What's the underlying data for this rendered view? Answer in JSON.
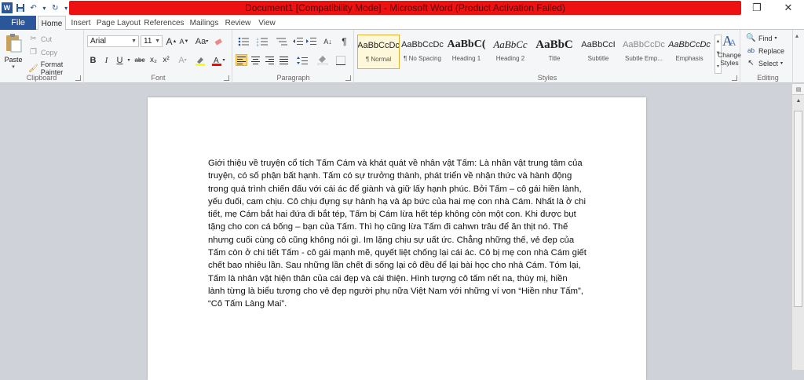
{
  "window": {
    "title": "Document1 [Compatibility Mode] - Microsoft Word (Product Activation Failed)",
    "logo": "W",
    "minimize": "—",
    "restore": "❐",
    "close": "✕"
  },
  "qat": {
    "save": "💾",
    "undo": "↶",
    "redo": "↻",
    "more": "▾"
  },
  "tabs": {
    "file": "File",
    "items": [
      "Home",
      "Insert",
      "Page Layout",
      "References",
      "Mailings",
      "Review",
      "View"
    ]
  },
  "clipboard": {
    "label": "Clipboard",
    "paste": "Paste",
    "cut": "Cut",
    "copy": "Copy",
    "format_painter": "Format Painter"
  },
  "font": {
    "label": "Font",
    "family": "Arial",
    "size": "11",
    "grow": "A",
    "shrink": "A",
    "case": "Aa",
    "bold": "B",
    "italic": "I",
    "underline": "U",
    "strike": "abc",
    "subscript": "x₂",
    "superscript": "x²",
    "highlight_color": "#ffff00",
    "font_color": "#ff0000"
  },
  "paragraph": {
    "label": "Paragraph",
    "sort": "A↓",
    "pilcrow": "¶"
  },
  "styles": {
    "label": "Styles",
    "items": [
      {
        "sample": "AaBbCcDc",
        "name": "¶ Normal"
      },
      {
        "sample": "AaBbCcDc",
        "name": "¶ No Spacing"
      },
      {
        "sample": "AaBbC(",
        "name": "Heading 1"
      },
      {
        "sample": "AaBbCc",
        "name": "Heading 2"
      },
      {
        "sample": "AaBbC",
        "name": "Title"
      },
      {
        "sample": "AaBbCcI",
        "name": "Subtitle"
      },
      {
        "sample": "AaBbCcDc",
        "name": "Subtle Emp..."
      },
      {
        "sample": "AaBbCcDc",
        "name": "Emphasis"
      }
    ],
    "change_styles_1": "Change",
    "change_styles_2": "Styles"
  },
  "editing": {
    "label": "Editing",
    "find": "Find",
    "replace": "Replace",
    "select": "Select"
  },
  "document": {
    "text": "Giới thiệu về truyện cổ tích Tấm Cám và khát quát về nhân vật Tấm: Là nhân vật trung tâm của truyện, có số phận bất hạnh. Tấm có sự trưởng thành, phát triển về nhận thức và hành động trong quá trình chiến đấu với cái ác để giành và giữ lấy hạnh phúc. Bởi Tấm – cô gái hiền lành, yếu đuối, cam chịu. Cô chịu đựng sự hành hạ và áp bức của hai mẹ con nhà Cám. Nhất là ở chi tiết, mẹ Cám bắt hai đứa đi bắt tép, Tấm bị Cám lừa hết tép không còn một con. Khi được bụt tặng cho con cá bống – bạn của Tấm. Thì họ cũng lừa Tấm đi cahwn trâu để ăn thịt nó. Thế nhưng cuối cùng cô cũng không nói gì. Im lặng chịu sự uất ức. Chẳng những thế, vẻ đẹp của Tấm còn ở chi tiết Tấm - cô gái mạnh mẽ, quyết liệt chống lại cái ác. Cô bị mẹ con nhà Cám giết chết bao nhiêu lần. Sau những lần chết đi sống lại cô đều để lại bài học cho nhà Cám. Tóm lại, Tấm là nhân vật hiện thân của cái đẹp và cái thiện. Hình tượng cô tấm nết na, thùy mị, hiền lành từng là biểu tượng cho vẻ đẹp người phụ nữa Việt Nam với những ví von “Hiền như Tấm”, “Cô Tấm Làng Mai”."
  }
}
